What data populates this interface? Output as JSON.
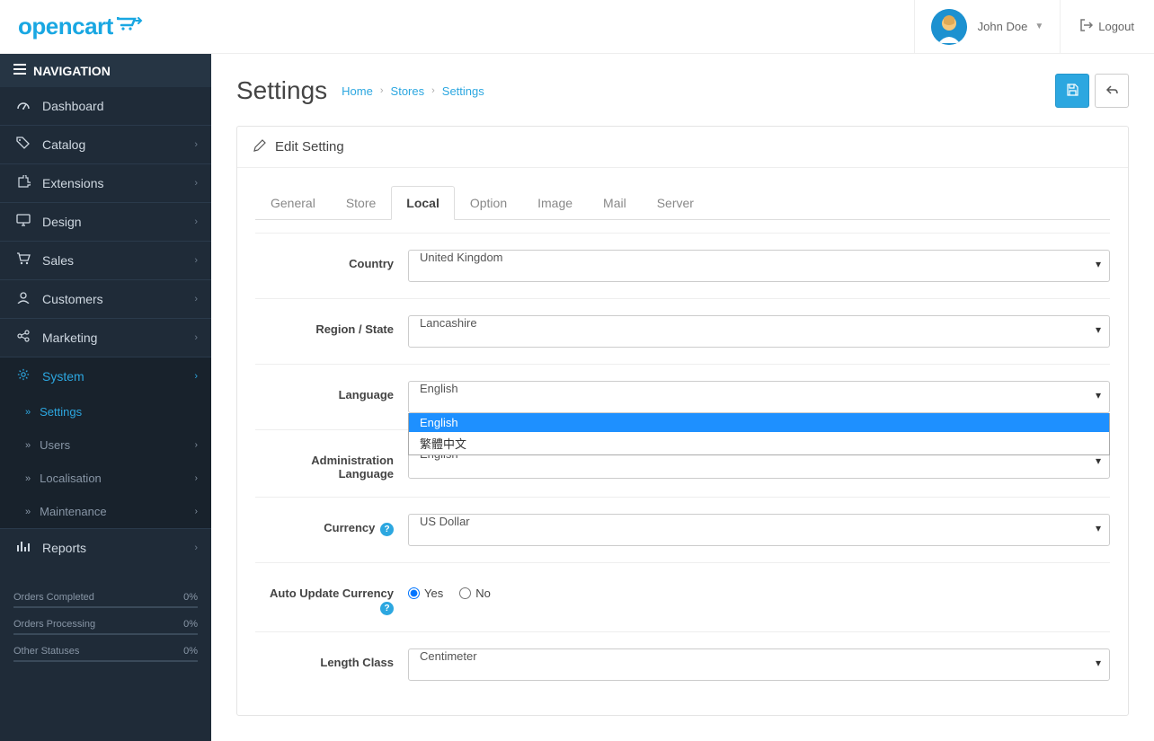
{
  "header": {
    "logo_text": "opencart",
    "user_name": "John Doe",
    "logout_label": "Logout"
  },
  "sidebar": {
    "title": "NAVIGATION",
    "items": [
      {
        "icon": "dashboard",
        "label": "Dashboard",
        "expandable": false
      },
      {
        "icon": "tags",
        "label": "Catalog",
        "expandable": true
      },
      {
        "icon": "puzzle",
        "label": "Extensions",
        "expandable": true
      },
      {
        "icon": "desktop",
        "label": "Design",
        "expandable": true
      },
      {
        "icon": "cart",
        "label": "Sales",
        "expandable": true
      },
      {
        "icon": "user",
        "label": "Customers",
        "expandable": true
      },
      {
        "icon": "share",
        "label": "Marketing",
        "expandable": true
      },
      {
        "icon": "cog",
        "label": "System",
        "expandable": true,
        "active": true
      },
      {
        "icon": "chart",
        "label": "Reports",
        "expandable": true
      }
    ],
    "system_sub": [
      {
        "label": "Settings",
        "active": true,
        "expandable": false
      },
      {
        "label": "Users",
        "expandable": true
      },
      {
        "label": "Localisation",
        "expandable": true
      },
      {
        "label": "Maintenance",
        "expandable": true
      }
    ],
    "stats": [
      {
        "label": "Orders Completed",
        "value": "0%"
      },
      {
        "label": "Orders Processing",
        "value": "0%"
      },
      {
        "label": "Other Statuses",
        "value": "0%"
      }
    ]
  },
  "page": {
    "title": "Settings",
    "breadcrumb": [
      "Home",
      "Stores",
      "Settings"
    ],
    "panel_title": "Edit Setting"
  },
  "tabs": [
    "General",
    "Store",
    "Local",
    "Option",
    "Image",
    "Mail",
    "Server"
  ],
  "active_tab": "Local",
  "form": {
    "country": {
      "label": "Country",
      "value": "United Kingdom"
    },
    "region": {
      "label": "Region / State",
      "value": "Lancashire"
    },
    "language": {
      "label": "Language",
      "value": "English",
      "options": [
        "English",
        "繁體中文"
      ]
    },
    "admin_language": {
      "label": "Administration Language",
      "value": "English"
    },
    "currency": {
      "label": "Currency",
      "value": "US Dollar",
      "help": true
    },
    "auto_update_currency": {
      "label": "Auto Update Currency",
      "yes": "Yes",
      "no": "No",
      "help": true
    },
    "length_class": {
      "label": "Length Class",
      "value": "Centimeter"
    }
  }
}
